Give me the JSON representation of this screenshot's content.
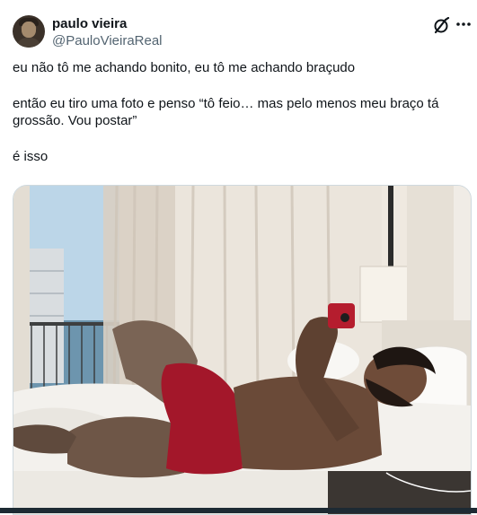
{
  "author": {
    "display_name": "paulo vieira",
    "handle": "@PauloVieiraReal"
  },
  "header_icons": [
    "grok-icon",
    "more-options-icon"
  ],
  "tweet": {
    "lines": [
      "eu não tô me achando bonito, eu tô me achando braçudo",
      "então eu tiro uma foto e penso “tô feio… mas pelo menos meu braço tá grossão. Vou postar”",
      "é isso"
    ]
  },
  "media": {
    "kind": "photo",
    "colors": {
      "wall": "#efe9e0",
      "curtain": "#ddd3c6",
      "sky": "#bcd6e8",
      "shorts": "#a3172a",
      "phone": "#b51d2e",
      "skin": "#6a4a38",
      "bed": "#f3f1ed"
    }
  }
}
